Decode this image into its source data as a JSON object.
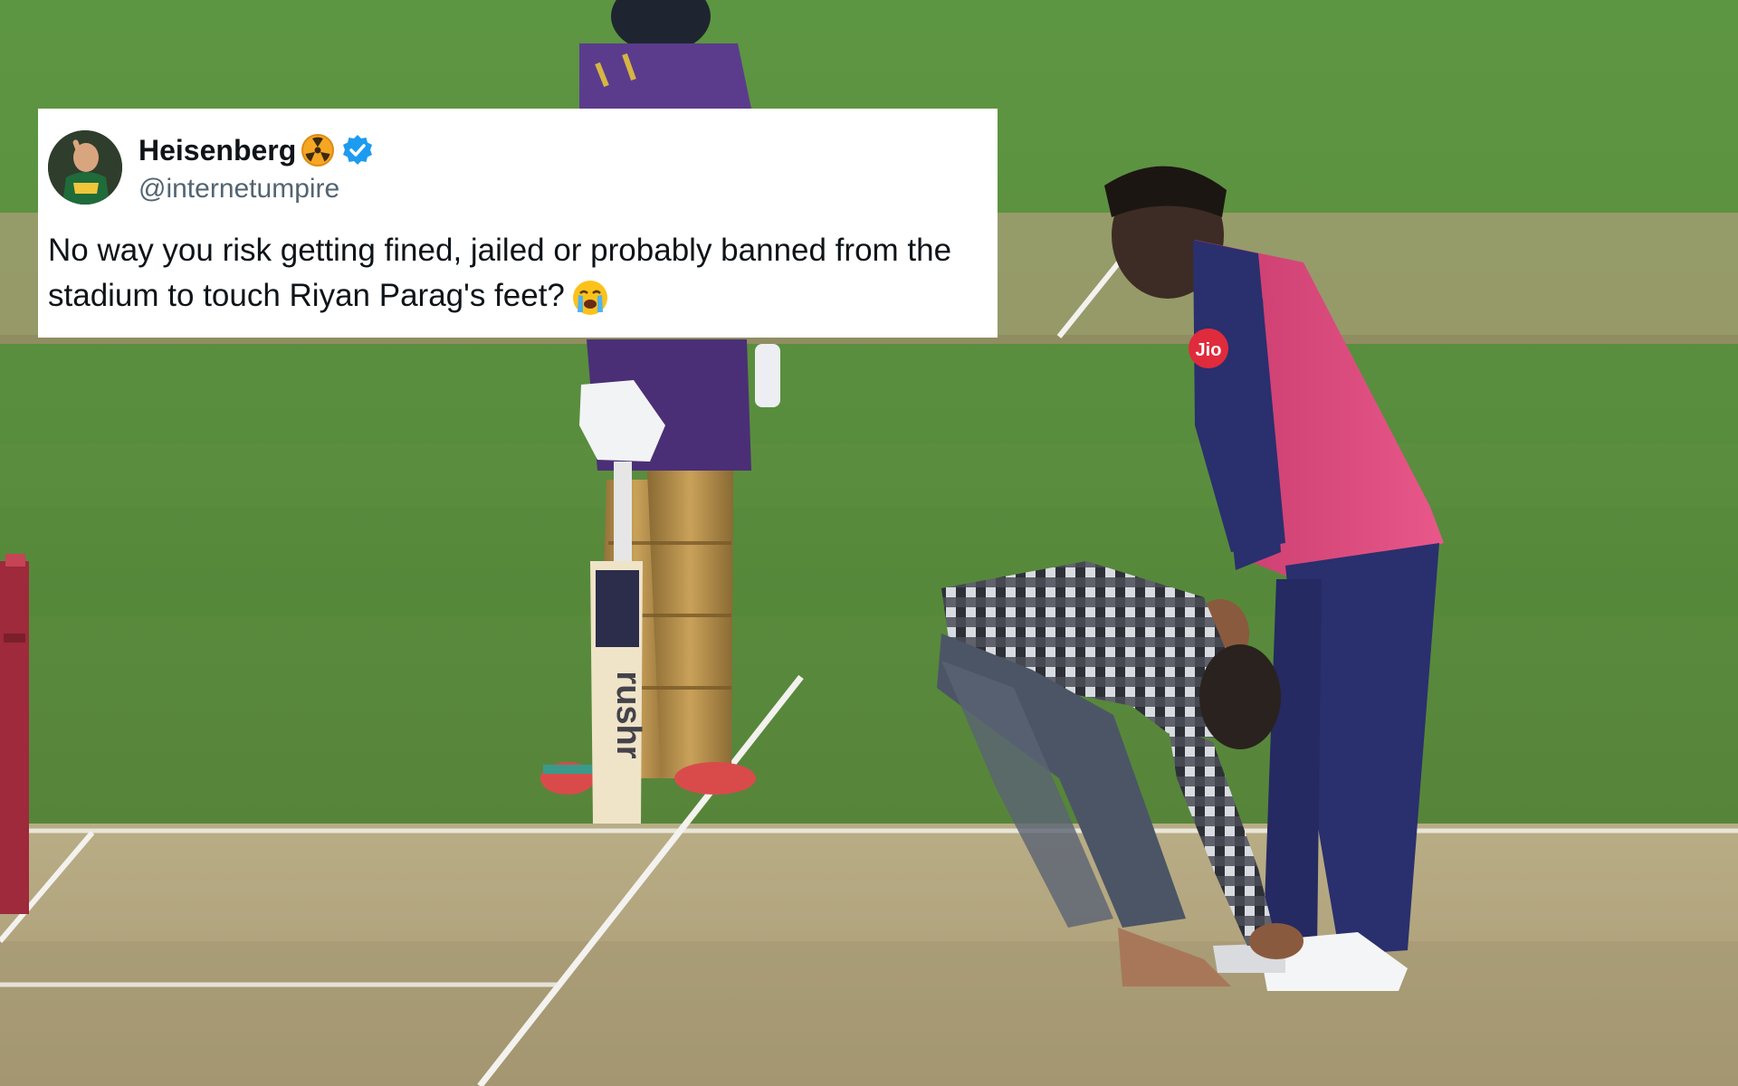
{
  "tweet": {
    "display_name": "Heisenberg",
    "handle": "@internetumpire",
    "text_line_1": "No way you risk getting fined, jailed or probably banned from the",
    "text_line_2": "stadium to touch Riyan Parag's feet?",
    "name_badges": [
      "radiation-icon",
      "verified-icon"
    ],
    "text_emoji": "loudly-crying-face-icon"
  },
  "photo": {
    "bat_brand": "rushr",
    "sponsor_logo": "Jio"
  },
  "colors": {
    "verified": "#1d9bf0",
    "radiation": "#f5a623",
    "pink_jersey": "#e0457b",
    "navy_jersey": "#2a2f6e",
    "purple_kit": "#5b3c8c",
    "pitch": "#c8b58a",
    "grass": "#5f8c3e"
  }
}
